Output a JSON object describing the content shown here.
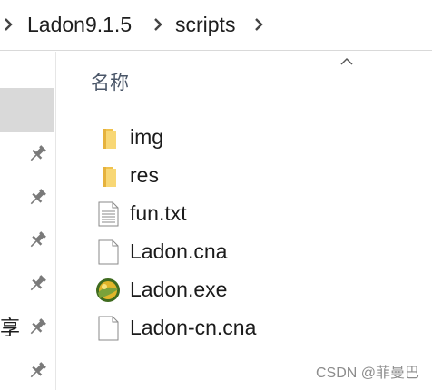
{
  "breadcrumb": {
    "segments": [
      "Ladon9.1.5",
      "scripts"
    ]
  },
  "nav": {
    "partial_label": "享"
  },
  "list": {
    "column_name": "名称",
    "items": [
      {
        "name": "img",
        "icon": "folder-icon"
      },
      {
        "name": "res",
        "icon": "folder-icon"
      },
      {
        "name": "fun.txt",
        "icon": "text-file-icon"
      },
      {
        "name": "Ladon.cna",
        "icon": "blank-file-icon"
      },
      {
        "name": "Ladon.exe",
        "icon": "ladon-app-icon"
      },
      {
        "name": "Ladon-cn.cna",
        "icon": "blank-file-icon"
      }
    ]
  },
  "watermark": "CSDN @菲曼巴",
  "colors": {
    "folder": "#f8d775",
    "selected": "#d9d9d9",
    "header_text": "#4a5668"
  }
}
